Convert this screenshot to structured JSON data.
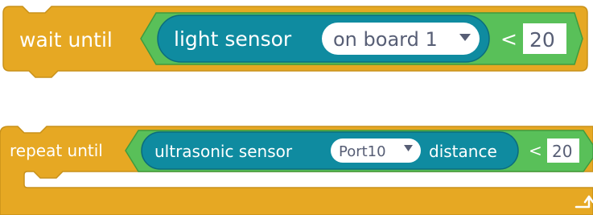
{
  "block1": {
    "keyword": "wait until",
    "reporter_label": "light sensor",
    "dropdown_value": "on board 1",
    "operator": "<",
    "number_value": "20"
  },
  "block2": {
    "keyword": "repeat until",
    "reporter_label": "ultrasonic sensor",
    "dropdown_value": "Port10",
    "reporter_suffix": "distance",
    "operator": "<",
    "number_value": "20"
  },
  "colors": {
    "control": "#e6a823",
    "control_edge": "#c8911a",
    "operator": "#59c059",
    "operator_edge": "#3f9b3f",
    "sensor": "#0f8ba0",
    "sensor_edge": "#0b6c7d"
  },
  "icons": {
    "dropdown_caret": "triangle-down",
    "loop_arrow": "loop-arrow"
  }
}
